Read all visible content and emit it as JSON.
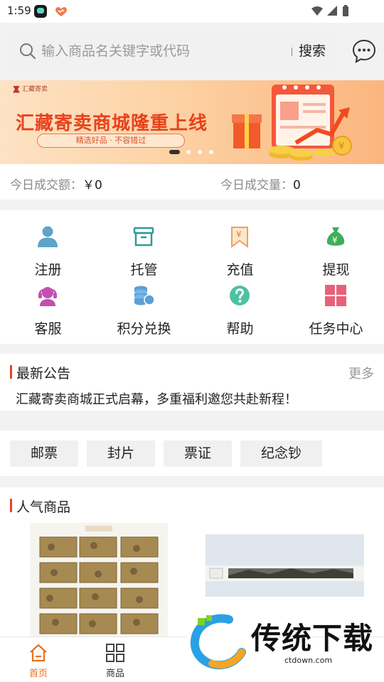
{
  "status_bar": {
    "time": "1:59"
  },
  "search": {
    "placeholder": "输入商品名关键字或代码",
    "button_label": "搜索"
  },
  "banner": {
    "logo_text": "汇藏寄卖",
    "title": "汇藏寄卖商城隆重上线",
    "subtitle": "精选好品 · 不容错过",
    "slide_count": 4,
    "active_slide": 1
  },
  "stats": {
    "turnover_label": "今日成交额：",
    "turnover_value": "￥0",
    "volume_label": "今日成交量：",
    "volume_value": "0"
  },
  "quick_actions": [
    {
      "label": "注册",
      "icon": "user-icon",
      "color": "#5ea3c8"
    },
    {
      "label": "托管",
      "icon": "archive-box-icon",
      "color": "#2f9c8e"
    },
    {
      "label": "充值",
      "icon": "yuan-envelope-icon",
      "color": "#e7a45c"
    },
    {
      "label": "提现",
      "icon": "money-bag-icon",
      "color": "#3fae5a"
    },
    {
      "label": "客服",
      "icon": "headset-icon",
      "color": "#c24fb1"
    },
    {
      "label": "积分兑换",
      "icon": "coin-stack-icon",
      "color": "#5aa0d8"
    },
    {
      "label": "帮助",
      "icon": "help-circle-icon",
      "color": "#4cc2a0"
    },
    {
      "label": "任务中心",
      "icon": "grid-icon",
      "color": "#e8607a"
    }
  ],
  "notice": {
    "title": "最新公告",
    "more_label": "更多",
    "text": "汇藏寄卖商城正式启幕，多重福利邀您共赴新程！"
  },
  "tags": [
    "邮票",
    "封片",
    "票证",
    "纪念钞"
  ],
  "popular": {
    "title": "人气商品"
  },
  "bottom_nav": [
    {
      "label": "首页",
      "icon": "home-icon",
      "active": true
    },
    {
      "label": "商品",
      "icon": "grid-apps-icon",
      "active": false
    }
  ],
  "watermark": {
    "text": "传统下载",
    "url": "ctdown.com"
  },
  "colors": {
    "accent": "#e8431c",
    "nav_active": "#e8721c"
  }
}
